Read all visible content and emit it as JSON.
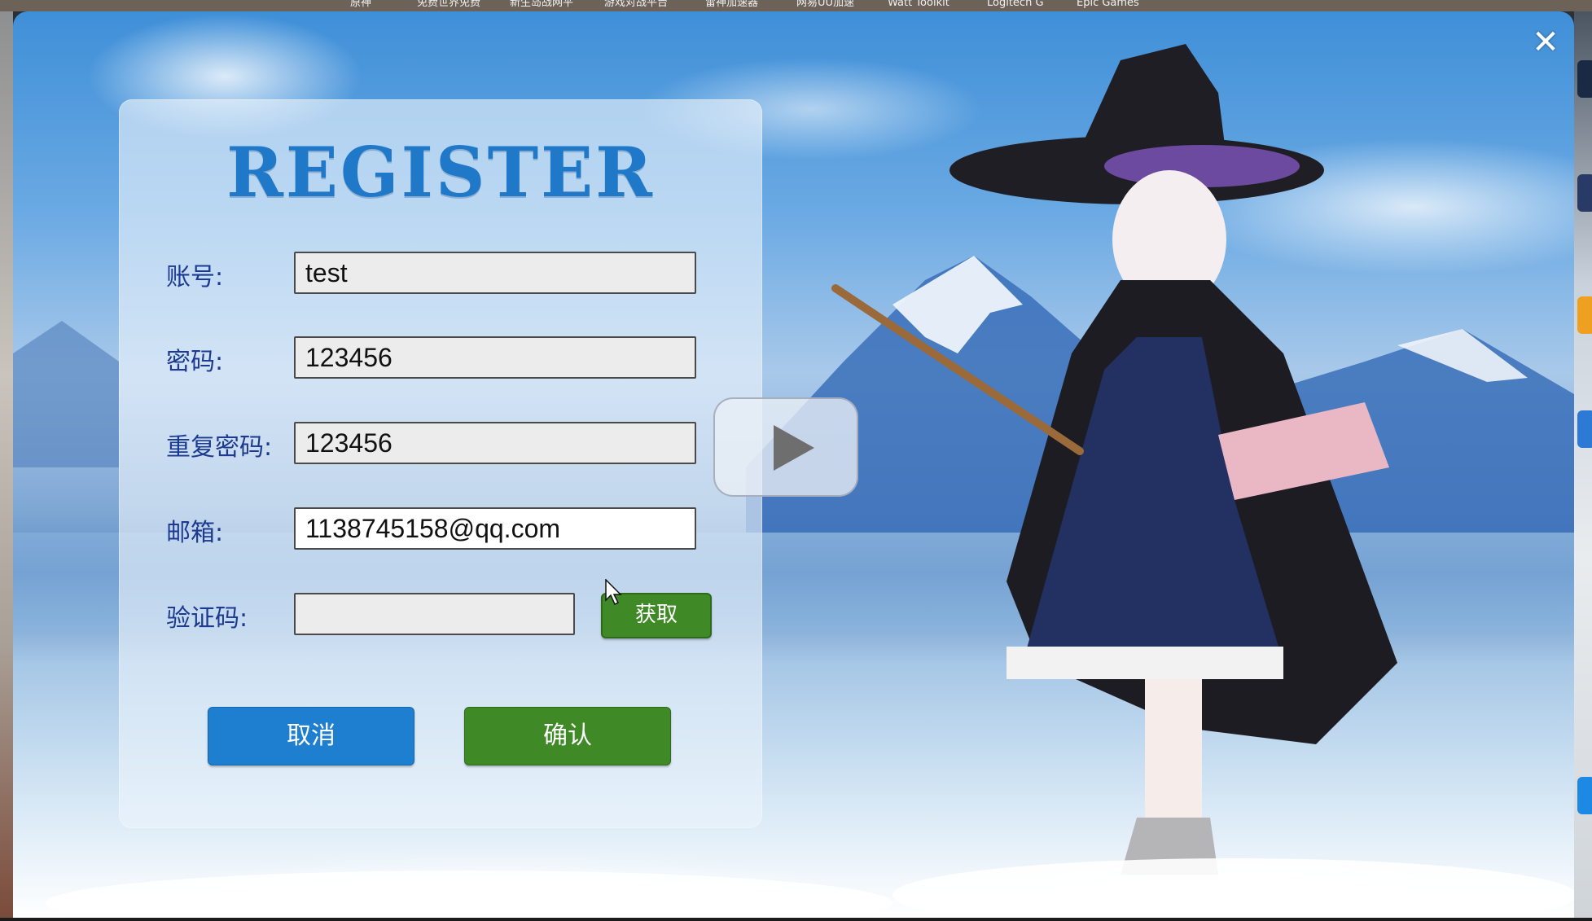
{
  "taskbar": {
    "items": [
      "原神",
      "免费世界免费",
      "新生岛战网平",
      "游戏对战平台",
      "雷神加速器",
      "网易UU加速",
      "Watt Toolkit",
      "Logitech G",
      "Epic Games"
    ]
  },
  "window": {
    "close_glyph": "✕",
    "title": "REGISTER"
  },
  "form": {
    "account": {
      "label": "账号:",
      "value": "test"
    },
    "password": {
      "label": "密码:",
      "value": "123456"
    },
    "repeat_password": {
      "label": "重复密码:",
      "value": "123456"
    },
    "email": {
      "label": "邮箱:",
      "value": "1138745158@qq.com"
    },
    "captcha": {
      "label": "验证码:",
      "value": "",
      "get_label": "获取"
    }
  },
  "actions": {
    "cancel_label": "取消",
    "confirm_label": "确认"
  },
  "media": {
    "play_icon": "play-icon"
  },
  "colors": {
    "title": "#1f78c8",
    "label": "#1c3a8f",
    "cancel": "#1e7fd0",
    "confirm": "#3f8a26"
  }
}
